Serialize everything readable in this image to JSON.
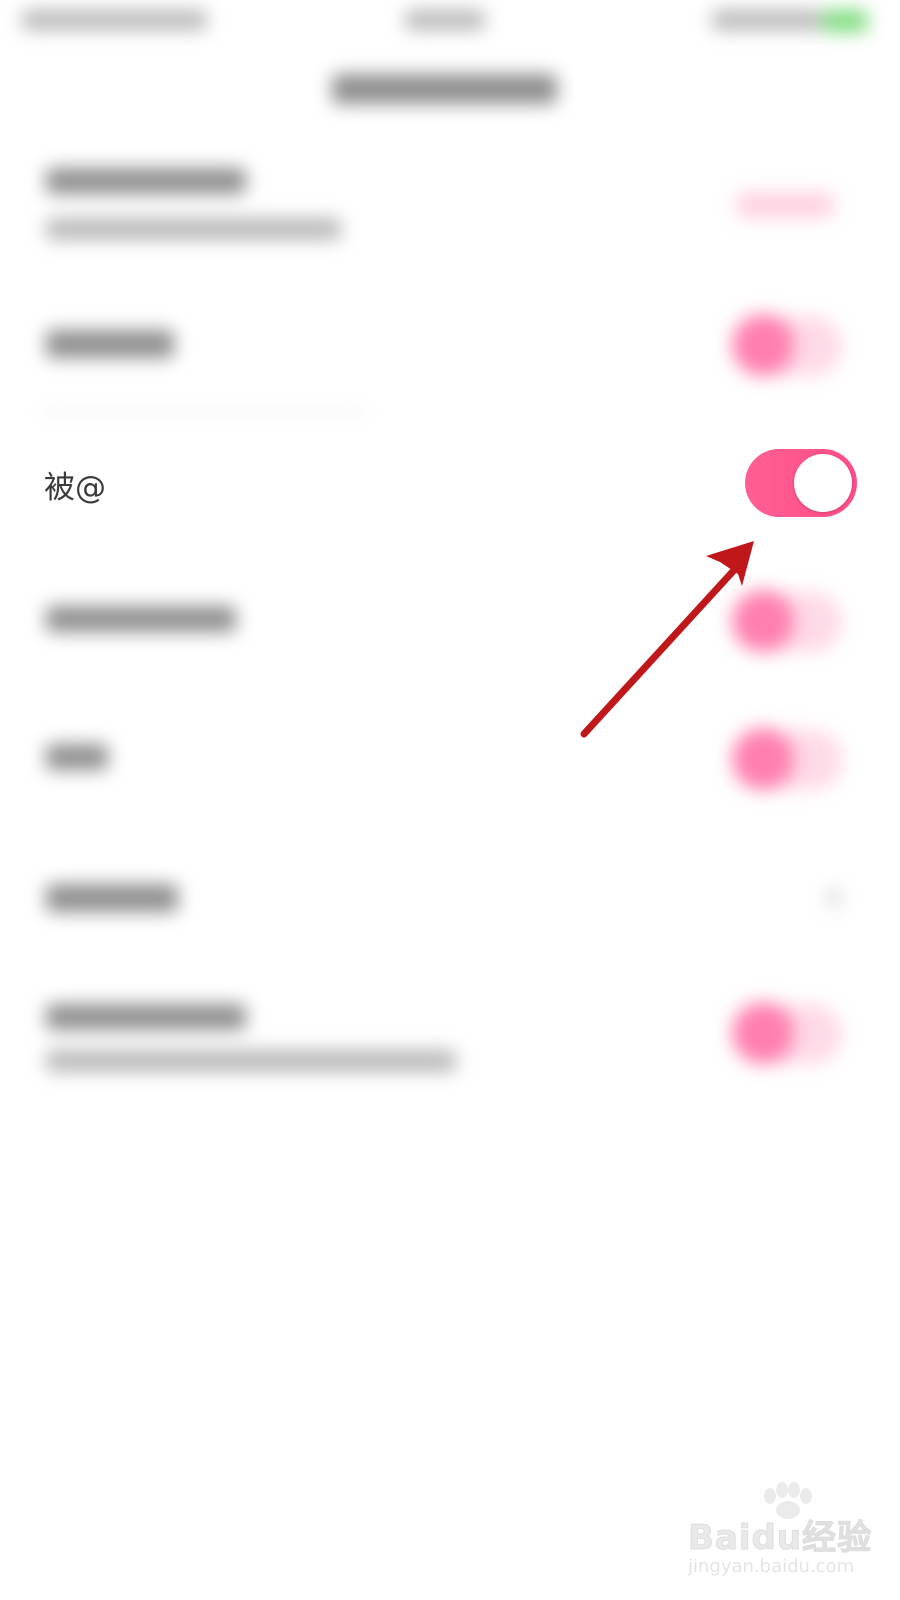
{
  "settings_row": {
    "label": "被@",
    "toggle_on": true
  },
  "colors": {
    "toggle_on": "#ff5288",
    "toggle_knob": "#ffffff",
    "arrow": "#c0171a",
    "label_text": "#3b3b3b"
  },
  "icons": {
    "annotation": "arrow-pointer-icon",
    "watermark_logo": "baidu-paw-icon"
  },
  "watermark": {
    "brand": "Baidu经验",
    "url": "jingyan.baidu.com"
  }
}
